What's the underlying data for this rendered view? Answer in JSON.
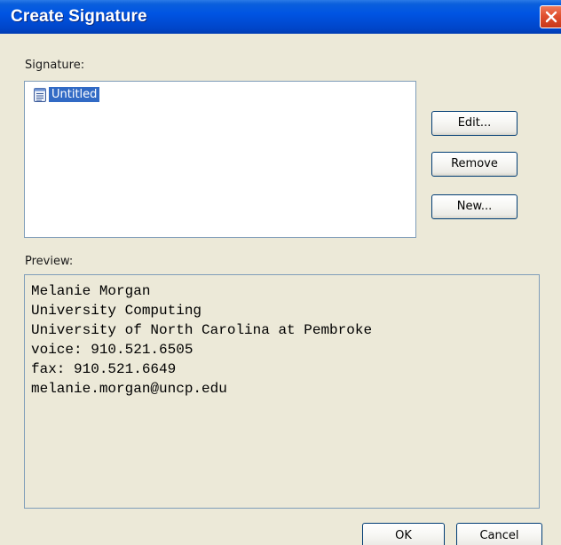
{
  "window": {
    "title": "Create Signature"
  },
  "signature": {
    "label": "Signature:",
    "items": [
      {
        "label": "Untitled",
        "selected": true,
        "icon": "document-icon"
      }
    ]
  },
  "buttons": {
    "edit": "Edit...",
    "remove": "Remove",
    "new": "New...",
    "ok": "OK",
    "cancel": "Cancel"
  },
  "preview": {
    "label": "Preview:",
    "lines": [
      "Melanie Morgan",
      "University Computing",
      "University of North Carolina at Pembroke",
      "voice: 910.521.6505",
      "fax: 910.521.6649",
      "melanie.morgan@uncp.edu"
    ]
  },
  "colors": {
    "titlebar": "#0054e3",
    "dialog_bg": "#ece9d8",
    "selection": "#316ac5",
    "close_button": "#e0502e"
  }
}
